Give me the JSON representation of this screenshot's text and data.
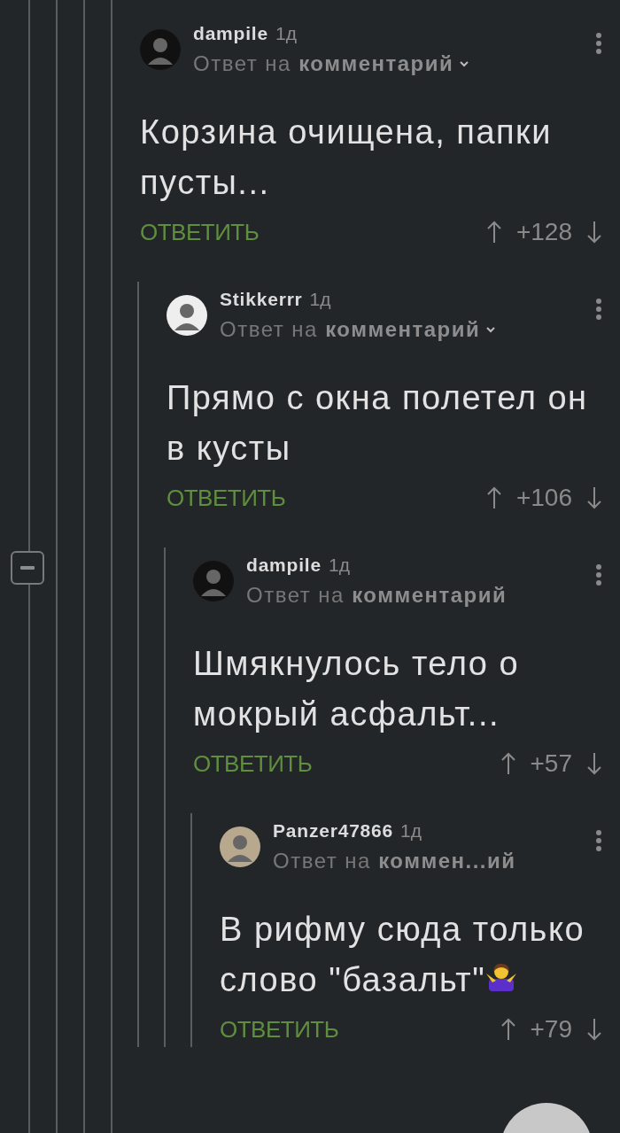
{
  "thread": {
    "expanded": true
  },
  "comments": [
    {
      "author": "dampile",
      "age": "1д",
      "reply_to": "Ответ на **комментарий**",
      "chevron": true,
      "color": "#111111",
      "text": "Корзина очищена, папки пусты...",
      "reaction_icon": false,
      "reply": "ОТВЕТИТЬ",
      "score": "+128",
      "children": [
        {
          "author": "Stikkerrr",
          "age": "1д",
          "reply_to": "Ответ на **комментарий**",
          "chevron": true,
          "color": "#eeeeee",
          "text": "Прямо с окна полетел он в кусты",
          "reaction_icon": false,
          "reply": "ОТВЕТИТЬ",
          "score": "+106",
          "children": [
            {
              "author": "dampile",
              "age": "1д",
              "reply_to": "Ответ на **комментарий**",
              "chevron": false,
              "color": "#111111",
              "text": "Шмякнулось тело о мокрый асфальт...",
              "reaction_icon": false,
              "reply": "ОТВЕТИТЬ",
              "score": "+57",
              "children": [
                {
                  "author": "Panzer47866",
                  "age": "1д",
                  "reply_to": "Ответ на **коммен...ий**",
                  "chevron": false,
                  "color": "#b8a98e",
                  "text": "В рифму сюда только слово \"базальт\"",
                  "reaction_icon": true,
                  "reply": "ОТВЕТИТЬ",
                  "score": "+79"
                }
              ]
            }
          ]
        }
      ]
    }
  ]
}
